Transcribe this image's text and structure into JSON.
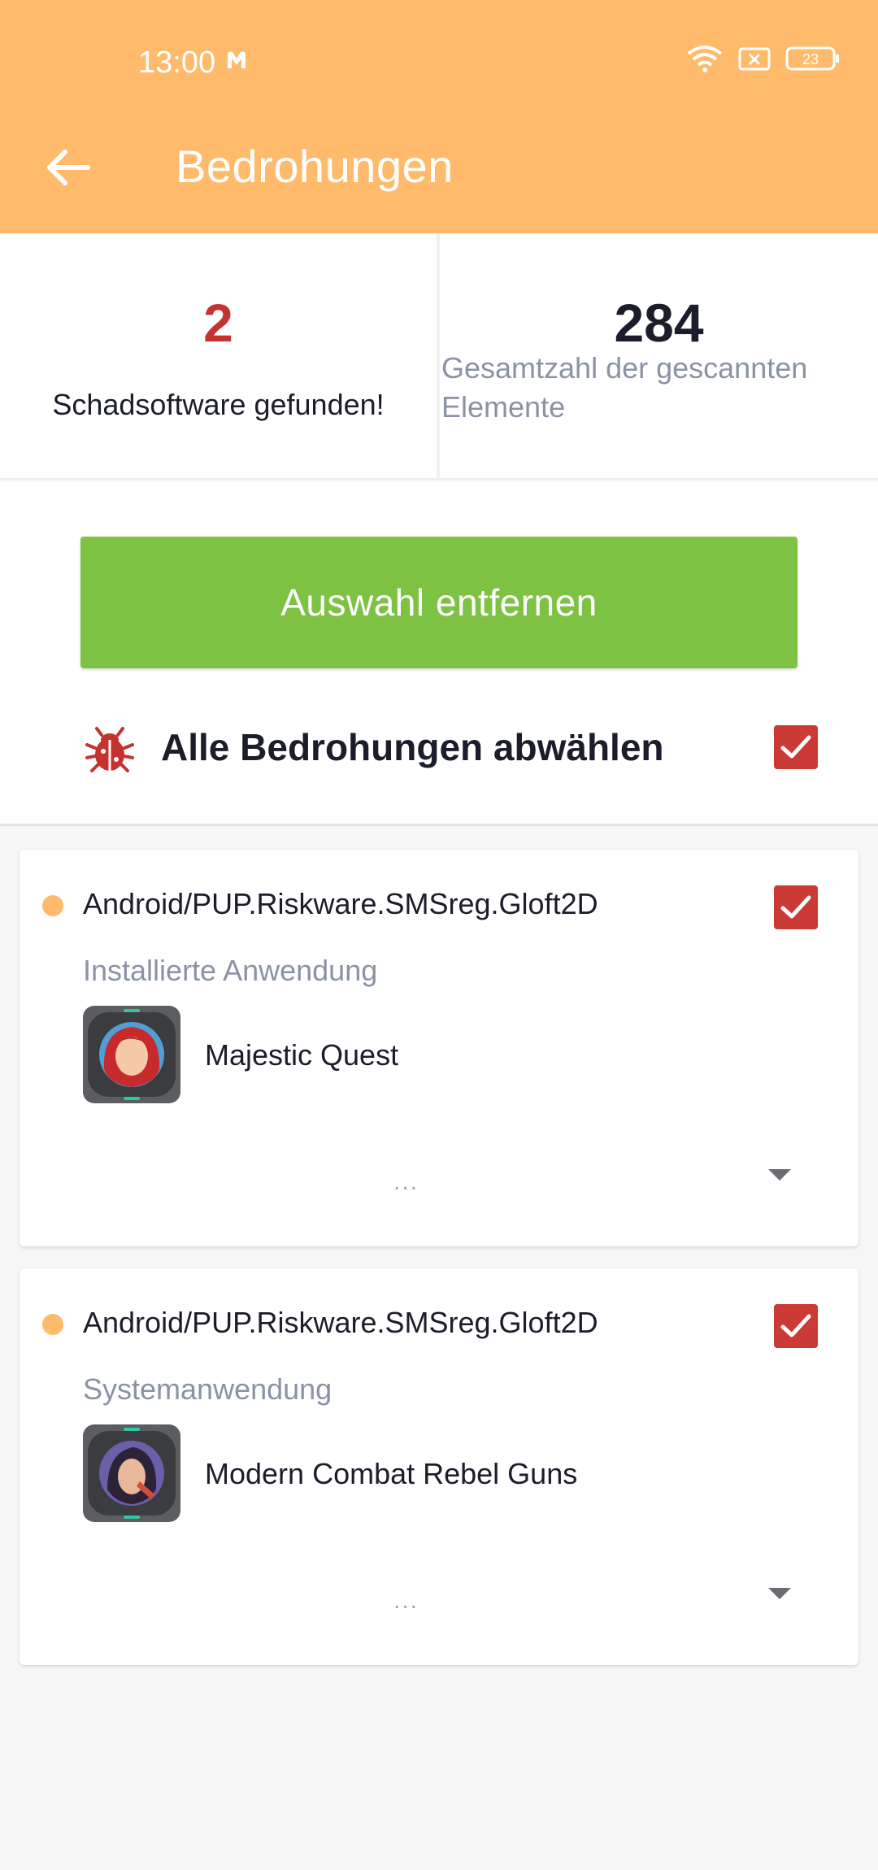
{
  "status_bar": {
    "time": "13:00",
    "battery": "23"
  },
  "header": {
    "title": "Bedrohungen"
  },
  "stats": {
    "malware_count": "2",
    "malware_label": "Schadsoftware gefunden!",
    "scanned_count": "284",
    "scanned_label": "Gesamtzahl der gescannten Elemente"
  },
  "actions": {
    "remove_button": "Auswahl entfernen",
    "deselect_all_label": "Alle Bedrohungen abwählen",
    "deselect_all_checked": true
  },
  "threats": [
    {
      "name": "Android/PUP.Riskware.SMSreg.Gloft2D",
      "category": "Installierte Anwendung",
      "app_name": "Majestic Quest",
      "more": "...",
      "checked": true
    },
    {
      "name": "Android/PUP.Riskware.SMSreg.Gloft2D",
      "category": "Systemanwendung",
      "app_name": "Modern Combat Rebel Guns",
      "more": "...",
      "checked": true
    }
  ],
  "colors": {
    "header_bg": "#ffbb6b",
    "accent_green": "#7dc243",
    "checkbox_red": "#cc3a36",
    "threat_dot": "#ffbb6b"
  }
}
